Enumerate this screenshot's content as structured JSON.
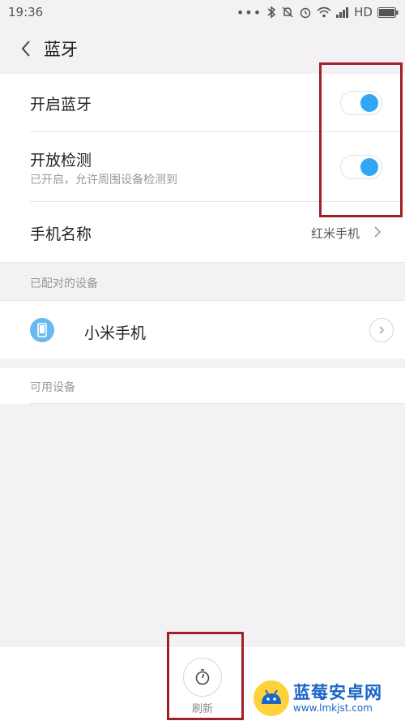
{
  "status_bar": {
    "time": "19:36",
    "network": "HD"
  },
  "header": {
    "title": "蓝牙"
  },
  "settings": {
    "bluetooth": {
      "label": "开启蓝牙",
      "on": true
    },
    "discoverable": {
      "label": "开放检测",
      "sub": "已开启，允许周围设备检测到",
      "on": true
    },
    "phone_name": {
      "label": "手机名称",
      "value": "红米手机"
    }
  },
  "paired": {
    "section_label": "已配对的设备",
    "devices": [
      {
        "name": "小米手机",
        "icon": "phone-icon"
      }
    ]
  },
  "available": {
    "section_label": "可用设备"
  },
  "bottom": {
    "refresh_label": "刷新",
    "icon": "refresh-icon"
  },
  "watermark": {
    "title": "蓝莓安卓网",
    "url": "www.lmkjst.com"
  },
  "colors": {
    "accent": "#31a7f3",
    "highlight": "#a02028",
    "watermark": "#1a66c8"
  }
}
